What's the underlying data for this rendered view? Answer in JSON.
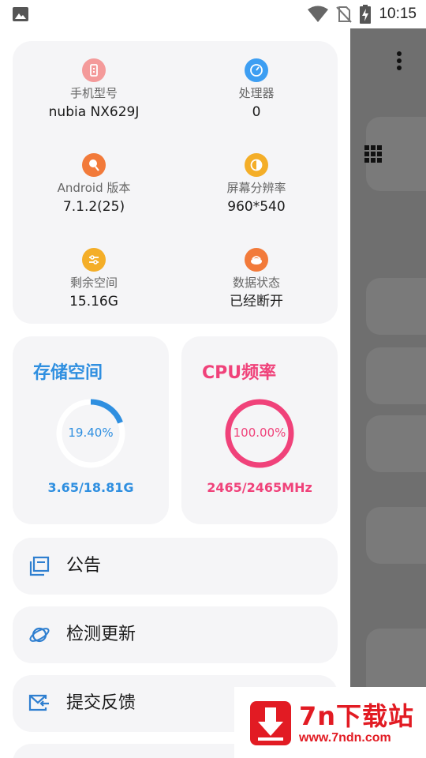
{
  "statusbar": {
    "time": "10:15"
  },
  "device_info": [
    {
      "label": "手机型号",
      "value": "nubia NX629J",
      "icon": "phone-icon",
      "color": "#f49a9a"
    },
    {
      "label": "处理器",
      "value": "0",
      "icon": "speedometer-icon",
      "color": "#3d9ef2"
    },
    {
      "label": "Android 版本",
      "value": "7.1.2(25)",
      "icon": "android-icon",
      "color": "#f27a3a"
    },
    {
      "label": "屏幕分辨率",
      "value": "960*540",
      "icon": "brightness-icon",
      "color": "#f4ae28"
    },
    {
      "label": "剩余空间",
      "value": "15.16G",
      "icon": "sliders-icon",
      "color": "#f4ae28"
    },
    {
      "label": "数据状态",
      "value": "已经断开",
      "icon": "data-icon",
      "color": "#f27a3a"
    }
  ],
  "storage": {
    "title": "存储空间",
    "percent_text": "19.40%",
    "percent": 19.4,
    "detail": "3.65/18.81G",
    "color": "#2f8fe0"
  },
  "cpu": {
    "title": "CPU频率",
    "percent_text": "100.00%",
    "percent": 100.0,
    "detail": "2465/2465MHz",
    "color": "#f0427a"
  },
  "menu": [
    {
      "label": "公告",
      "icon": "notice-icon"
    },
    {
      "label": "检测更新",
      "icon": "planet-icon"
    },
    {
      "label": "提交反馈",
      "icon": "mail-icon"
    }
  ],
  "watermark": {
    "title": "7n下载站",
    "url": "www.7ndn.com"
  }
}
